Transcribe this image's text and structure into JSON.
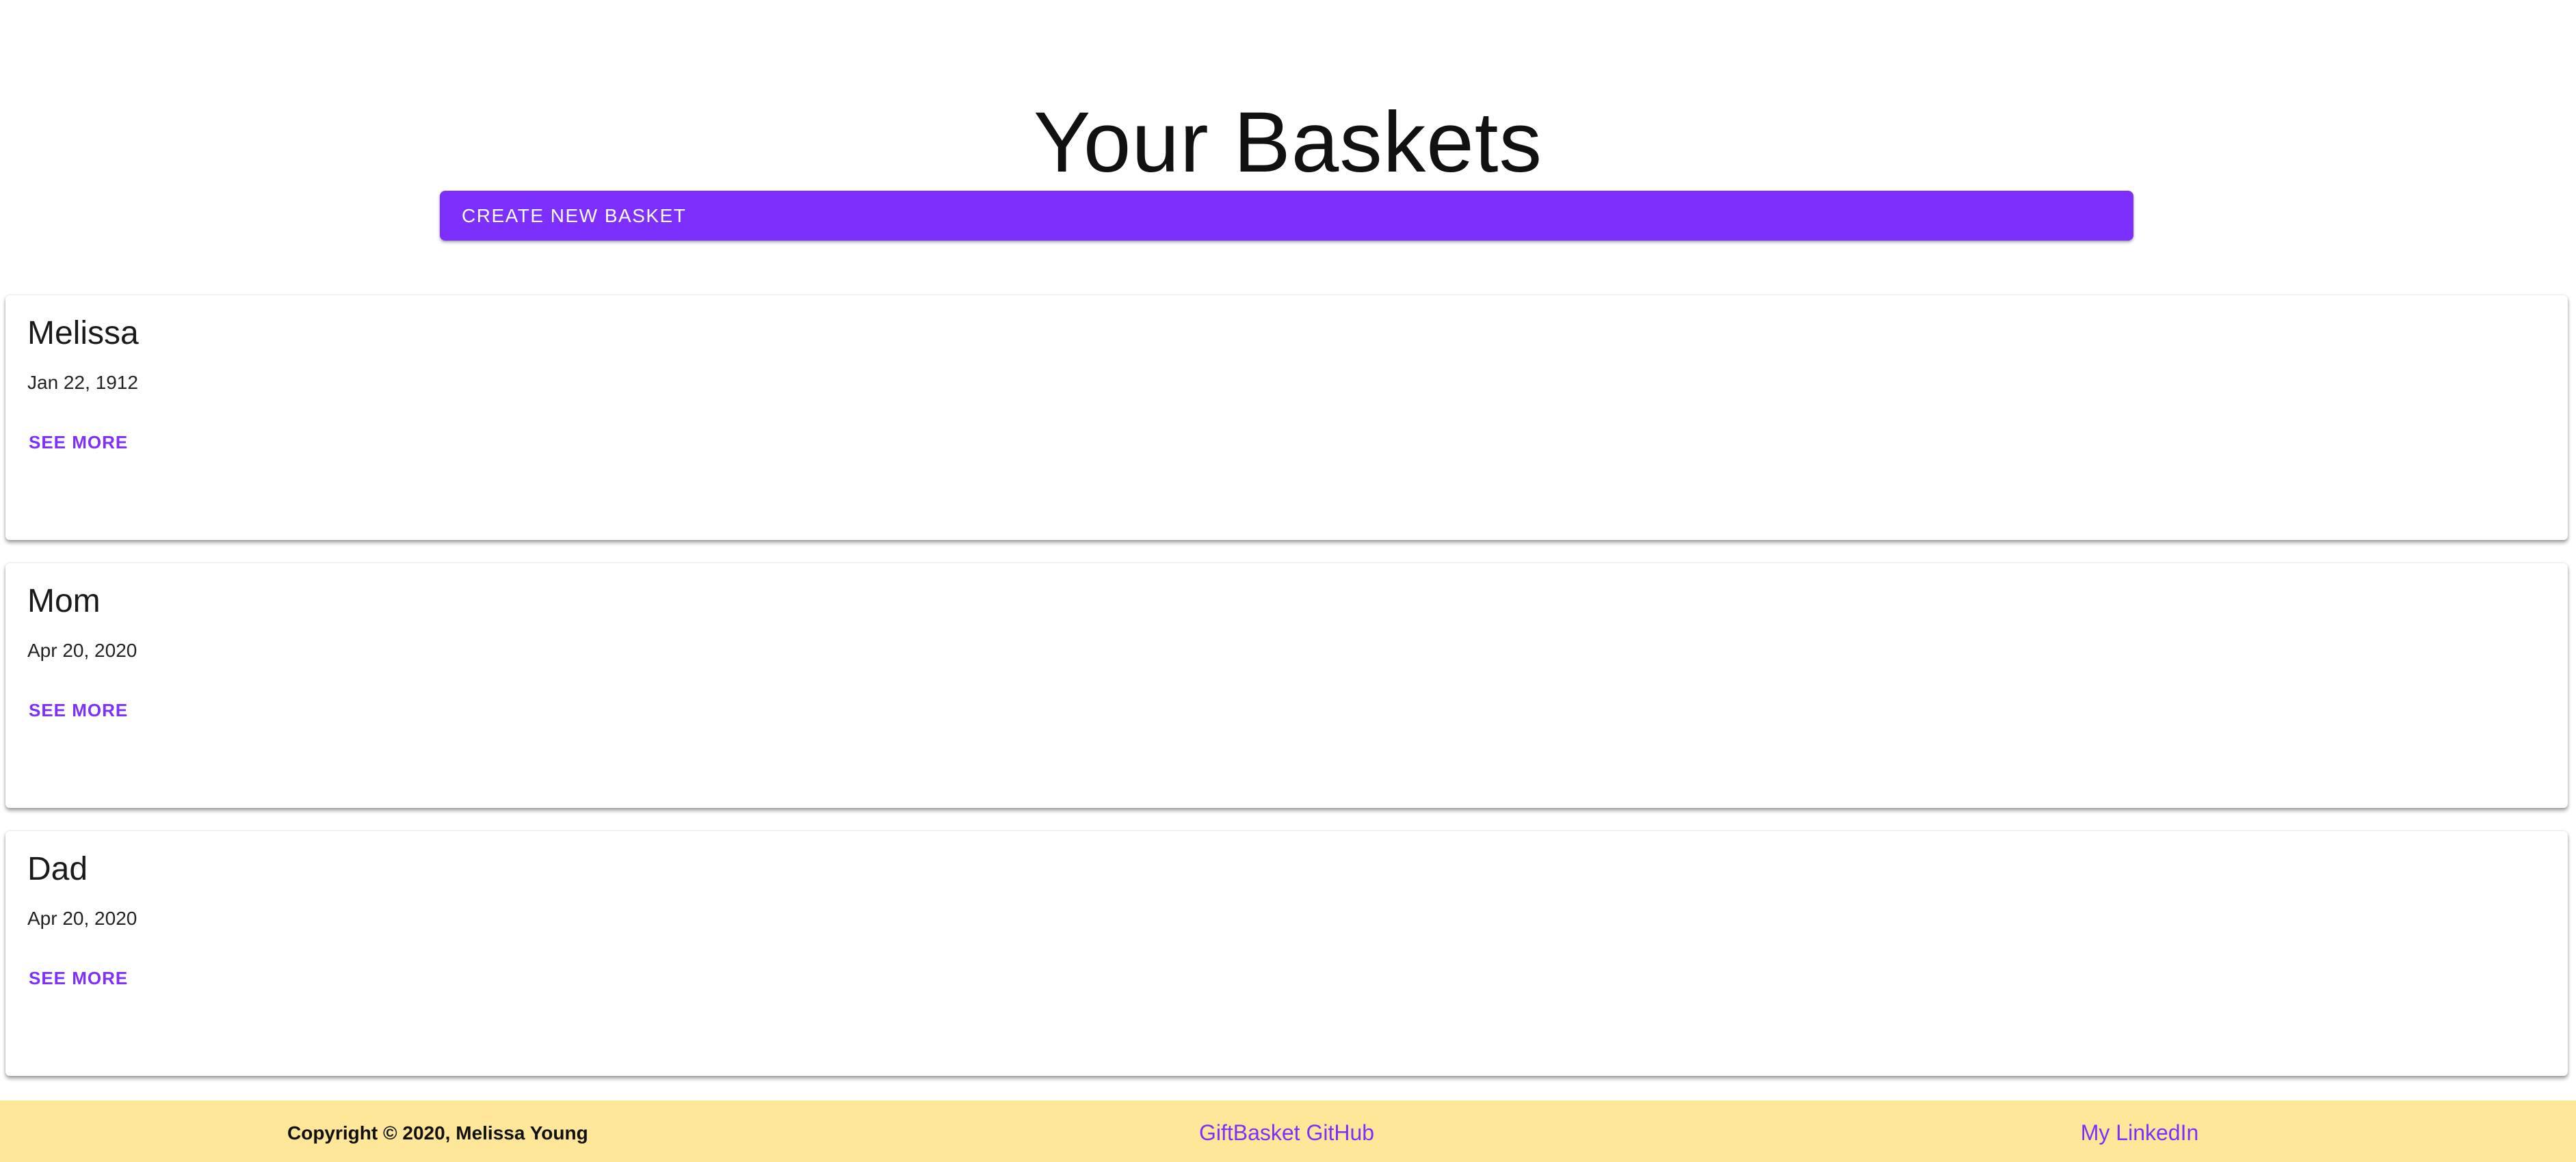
{
  "page": {
    "title": "Your Baskets"
  },
  "toolbar": {
    "create_label": "CREATE NEW BASKET"
  },
  "baskets": [
    {
      "name": "Melissa",
      "date": "Jan 22, 1912",
      "action_label": "SEE MORE"
    },
    {
      "name": "Mom",
      "date": "Apr 20, 2020",
      "action_label": "SEE MORE"
    },
    {
      "name": "Dad",
      "date": "Apr 20, 2020",
      "action_label": "SEE MORE"
    }
  ],
  "footer": {
    "copyright": "Copyright © 2020, Melissa Young",
    "github_label": "GiftBasket GitHub",
    "linkedin_label": "My LinkedIn"
  },
  "colors": {
    "accent": "#7c2ffd",
    "footer_bg": "#fee799"
  }
}
